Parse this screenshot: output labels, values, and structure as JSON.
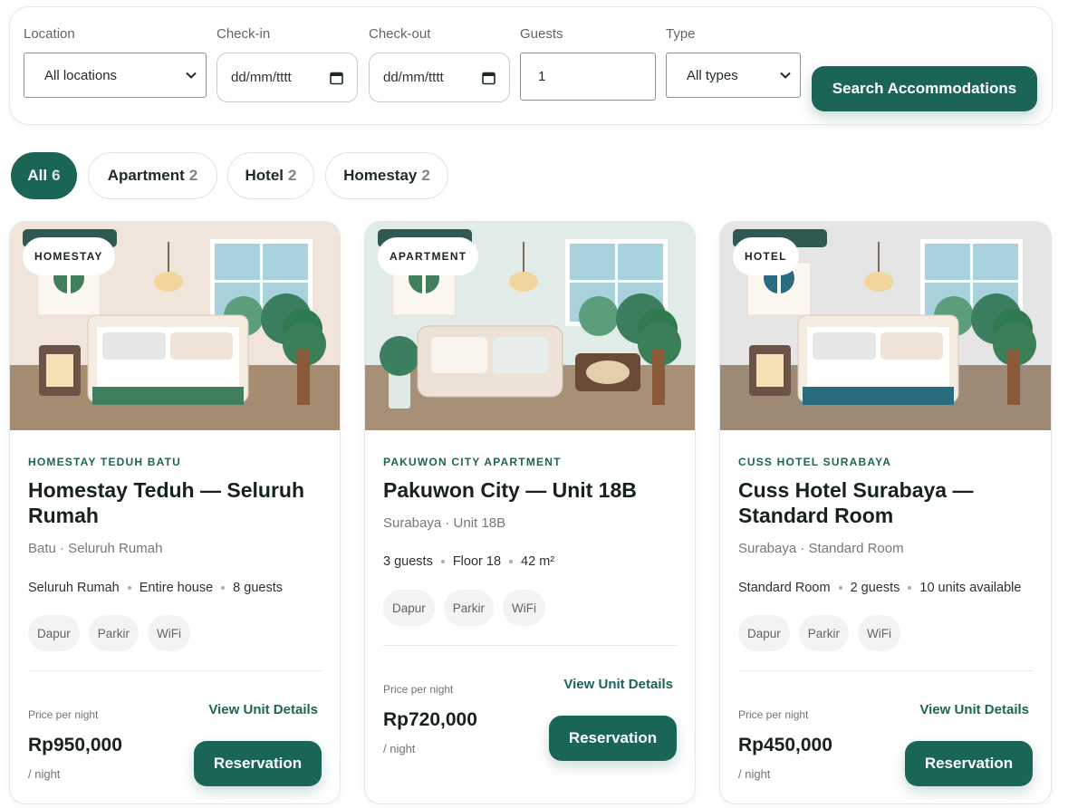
{
  "search": {
    "location_label": "Location",
    "location_value": "All locations",
    "checkin_label": "Check-in",
    "checkin_placeholder": "dd/mm/tttt",
    "checkout_label": "Check-out",
    "checkout_placeholder": "dd/mm/tttt",
    "guests_label": "Guests",
    "guests_value": "1",
    "type_label": "Type",
    "type_value": "All types",
    "search_button": "Search Accommodations"
  },
  "tabs": [
    {
      "label": "All",
      "count": "6",
      "active": true
    },
    {
      "label": "Apartment",
      "count": "2",
      "active": false
    },
    {
      "label": "Hotel",
      "count": "2",
      "active": false
    },
    {
      "label": "Homestay",
      "count": "2",
      "active": false
    }
  ],
  "cards": [
    {
      "badge": "HOMESTAY",
      "property": "HOMESTAY TEDUH BATU",
      "title": "Homestay Teduh — Seluruh Rumah",
      "subtitle": "Batu · Seluruh Rumah",
      "meta": [
        "Seluruh Rumah",
        "Entire house",
        "8 guests"
      ],
      "amenities": [
        "Dapur",
        "Parkir",
        "WiFi"
      ],
      "price_label": "Price per night",
      "price": "Rp950,000",
      "per": "/ night",
      "details_link": "View Unit Details",
      "reserve_button": "Reservation"
    },
    {
      "badge": "APARTMENT",
      "property": "PAKUWON CITY APARTMENT",
      "title": "Pakuwon City — Unit 18B",
      "subtitle": "Surabaya · Unit 18B",
      "meta": [
        "3 guests",
        "Floor 18",
        "42 m²"
      ],
      "amenities": [
        "Dapur",
        "Parkir",
        "WiFi"
      ],
      "price_label": "Price per night",
      "price": "Rp720,000",
      "per": "/ night",
      "details_link": "View Unit Details",
      "reserve_button": "Reservation"
    },
    {
      "badge": "HOTEL",
      "property": "CUSS HOTEL SURABAYA",
      "title": "Cuss Hotel Surabaya — Standard Room",
      "subtitle": "Surabaya · Standard Room",
      "meta": [
        "Standard Room",
        "2 guests",
        "10 units available"
      ],
      "amenities": [
        "Dapur",
        "Parkir",
        "WiFi"
      ],
      "price_label": "Price per night",
      "price": "Rp450,000",
      "per": "/ night",
      "details_link": "View Unit Details",
      "reserve_button": "Reservation"
    }
  ],
  "colors": {
    "brand": "#1b6556",
    "homestay_wall": "#f1e6dc",
    "apartment_wall": "#e3ece9",
    "hotel_wall": "#e5e6e5",
    "homestay_bed": "#3f7f5d",
    "hotel_bed": "#2a6b80"
  }
}
